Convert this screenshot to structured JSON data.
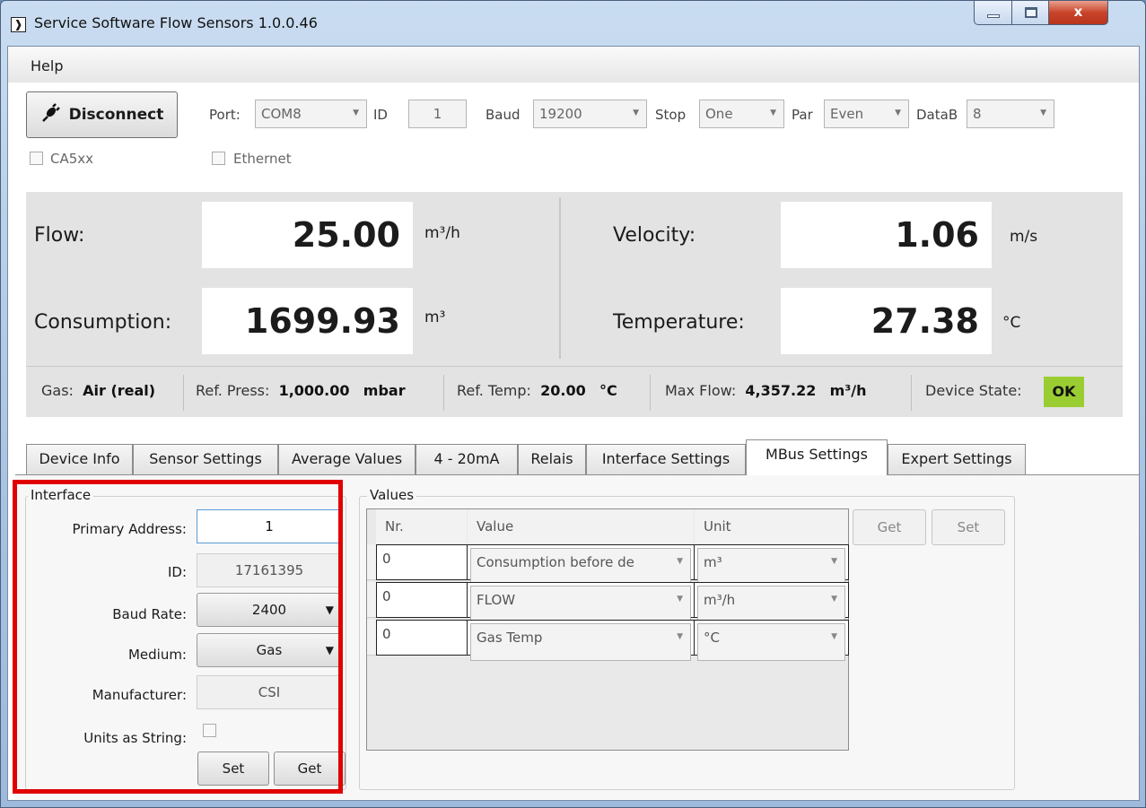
{
  "window": {
    "title": "Service Software Flow Sensors 1.0.0.46",
    "icon_glyph": "❱",
    "close_glyph": "x"
  },
  "menu": {
    "help": "Help"
  },
  "connection": {
    "disconnect_label": "Disconnect",
    "port_label": "Port:",
    "port_value": "COM8",
    "id_label": "ID",
    "id_value": "1",
    "baud_label": "Baud",
    "baud_value": "19200",
    "stop_label": "Stop",
    "stop_value": "One",
    "par_label": "Par",
    "par_value": "Even",
    "datab_label": "DataB",
    "datab_value": "8",
    "ca5xx_label": "CA5xx",
    "ethernet_label": "Ethernet"
  },
  "measurements": {
    "flow_label": "Flow:",
    "flow_value": "25.00",
    "flow_unit": "m³/h",
    "consumption_label": "Consumption:",
    "consumption_value": "1699.93",
    "consumption_unit": "m³",
    "velocity_label": "Velocity:",
    "velocity_value": "1.06",
    "velocity_unit": "m/s",
    "temperature_label": "Temperature:",
    "temperature_value": "27.38",
    "temperature_unit": "°C"
  },
  "info": {
    "gas_label": "Gas:",
    "gas_value": "Air (real)",
    "ref_press_label": "Ref. Press:",
    "ref_press_value": "1,000.00",
    "ref_press_unit": "mbar",
    "ref_temp_label": "Ref. Temp:",
    "ref_temp_value": "20.00",
    "ref_temp_unit": "°C",
    "max_flow_label": "Max Flow:",
    "max_flow_value": "4,357.22",
    "max_flow_unit": "m³/h",
    "device_state_label": "Device State:",
    "device_state_value": "OK",
    "ok_color": "#9acd32"
  },
  "tabs": [
    {
      "label": "Device Info"
    },
    {
      "label": "Sensor Settings"
    },
    {
      "label": "Average Values"
    },
    {
      "label": "4 - 20mA"
    },
    {
      "label": "Relais"
    },
    {
      "label": "Interface Settings"
    },
    {
      "label": "MBus Settings"
    },
    {
      "label": "Expert Settings"
    }
  ],
  "active_tab": "MBus Settings",
  "interface": {
    "title": "Interface",
    "primary_address_label": "Primary Address:",
    "primary_address_value": "1",
    "id_label": "ID:",
    "id_value": "17161395",
    "baud_rate_label": "Baud Rate:",
    "baud_rate_value": "2400",
    "medium_label": "Medium:",
    "medium_value": "Gas",
    "manufacturer_label": "Manufacturer:",
    "manufacturer_value": "CSI",
    "units_as_string_label": "Units as String:",
    "set_label": "Set",
    "get_label": "Get"
  },
  "values": {
    "title": "Values",
    "columns": [
      "Nr.",
      "Value",
      "Unit"
    ],
    "rows": [
      {
        "nr": "0",
        "value": "Consumption before de",
        "unit": "m³"
      },
      {
        "nr": "0",
        "value": "FLOW",
        "unit": "m³/h"
      },
      {
        "nr": "0",
        "value": "Gas Temp",
        "unit": "°C"
      }
    ],
    "get_label": "Get",
    "set_label": "Set"
  },
  "highlight_color": "#e00000"
}
